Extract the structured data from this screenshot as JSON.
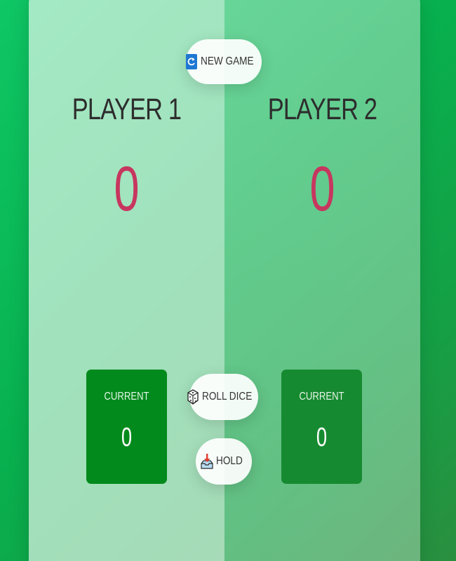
{
  "buttons": {
    "new_game": {
      "label": "NEW GAME",
      "icon": "refresh-icon"
    },
    "roll_dice": {
      "label": "ROLL DICE",
      "icon": "dice-icon"
    },
    "hold": {
      "label": "HOLD",
      "icon": "inbox-tray-icon"
    }
  },
  "players": [
    {
      "name": "PLAYER 1",
      "score": "0",
      "current_label": "CURRENT",
      "current_score": "0",
      "active": true
    },
    {
      "name": "PLAYER 2",
      "score": "0",
      "current_label": "CURRENT",
      "current_score": "0",
      "active": false
    }
  ],
  "colors": {
    "background_start": "#0fc765",
    "background_end": "#2a8f3f",
    "score": "#c7365f",
    "current_box_1": "#028a1c",
    "current_box_2": "#168a30"
  }
}
